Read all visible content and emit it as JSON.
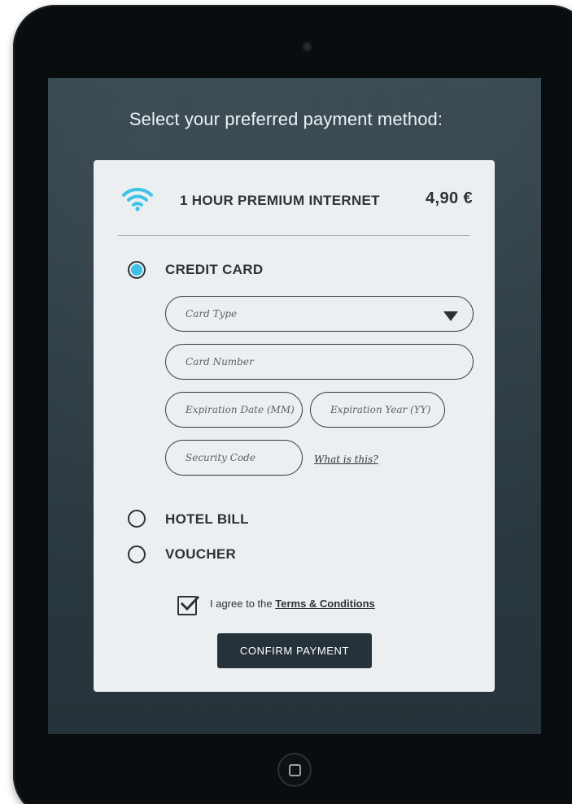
{
  "prompt": "Select your preferred payment method:",
  "product": {
    "icon": "wifi-icon",
    "name": "1 HOUR PREMIUM INTERNET",
    "price": "4,90 €"
  },
  "payment_options": [
    {
      "label": "CREDIT CARD",
      "selected": true
    },
    {
      "label": "HOTEL BILL",
      "selected": false
    },
    {
      "label": "VOUCHER",
      "selected": false
    }
  ],
  "credit_card_form": {
    "card_type_placeholder": "Card Type",
    "card_number_placeholder": "Card Number",
    "expiration_month_placeholder": "Expiration Date (MM)",
    "expiration_year_placeholder": "Expiration Year (YY)",
    "security_code_placeholder": "Security Code",
    "what_is_this_link": "What is this?"
  },
  "terms": {
    "checked": true,
    "prefix": "I agree to the",
    "link_text": "Terms & Conditions"
  },
  "confirm_label": "CONFIRM PAYMENT",
  "colors": {
    "accent": "#3ec3e6",
    "dark": "#2b3338",
    "button": "#26323a",
    "panel": "#eceff1"
  }
}
